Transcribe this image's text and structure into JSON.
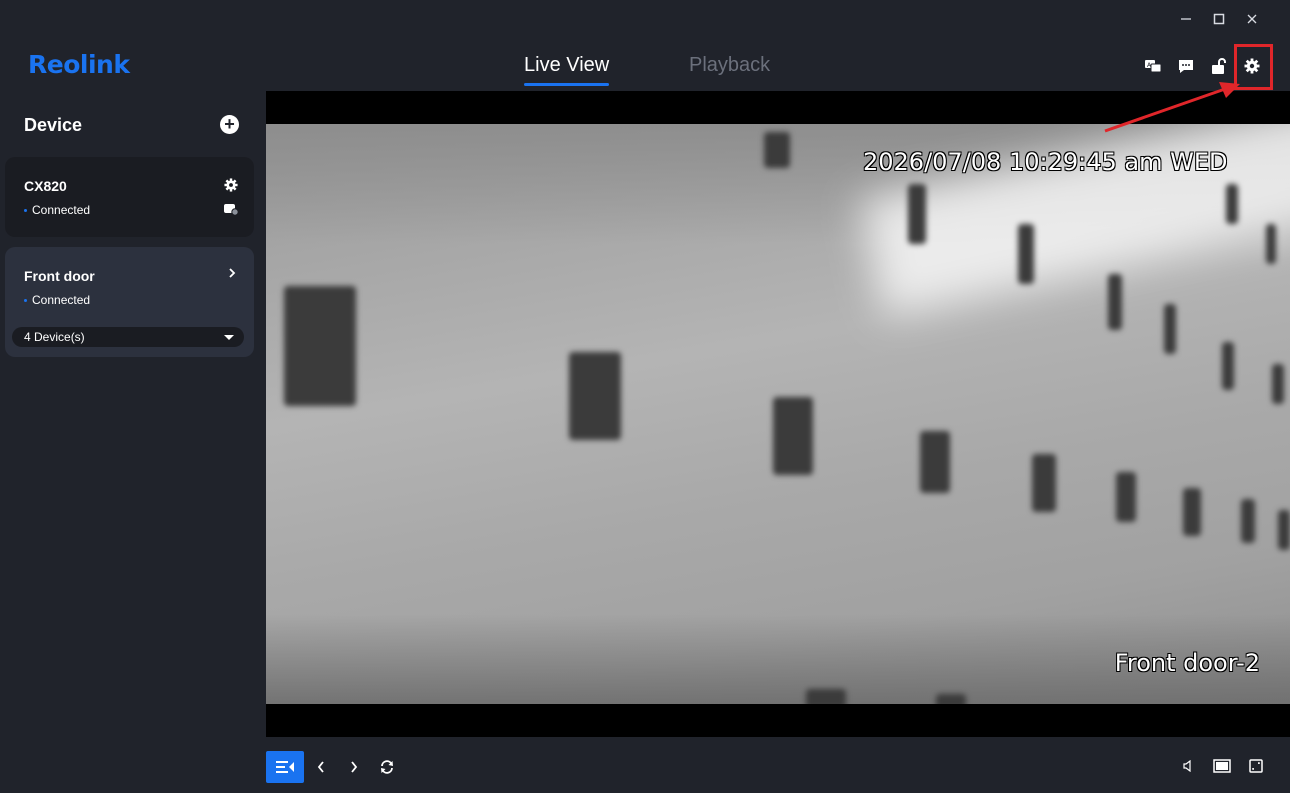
{
  "window": {
    "minimize": "—",
    "maximize": "☐",
    "close": "✕"
  },
  "header": {
    "logo": "Reolink",
    "tabs": [
      {
        "label": "Live View",
        "active": true
      },
      {
        "label": "Playback",
        "active": false
      }
    ],
    "icons": [
      "translate-icon",
      "message-icon",
      "unlock-icon",
      "settings-icon"
    ]
  },
  "sidebar": {
    "title": "Device",
    "devices": [
      {
        "name": "CX820",
        "status": "Connected"
      },
      {
        "name": "Front door",
        "status": "Connected",
        "selector": "4 Device(s)"
      }
    ]
  },
  "video": {
    "timestamp": "2026/07/08 10:29:45 am WED",
    "camera_name": "Front door-2"
  },
  "colors": {
    "accent": "#1a73f0",
    "background": "#20232b",
    "highlight": "#e0262a"
  }
}
